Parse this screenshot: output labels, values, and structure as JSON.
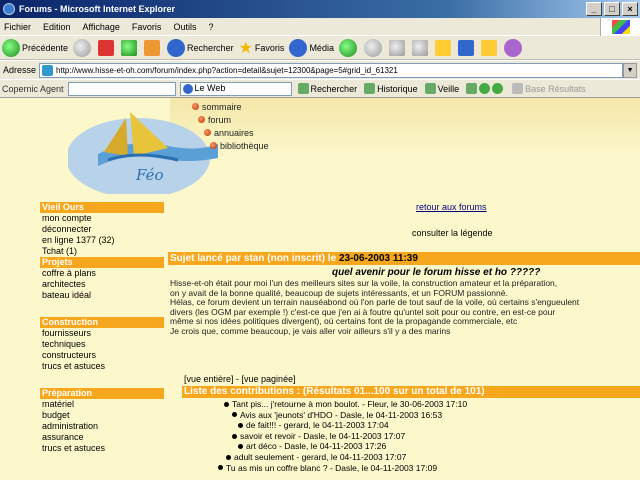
{
  "window": {
    "title": "Forums - Microsoft Internet Explorer",
    "controls": [
      "_",
      "□",
      "×"
    ]
  },
  "menu": [
    "Fichier",
    "Edition",
    "Affichage",
    "Favoris",
    "Outils",
    "?"
  ],
  "toolbar": {
    "back": "Précédente",
    "search": "Rechercher",
    "favorites": "Favoris",
    "media": "Média"
  },
  "address": {
    "label": "Adresse",
    "url": "http://www.hisse-et-oh.com/forum/index.php?action=detail&sujet=12300&page=5#grid_id_61321"
  },
  "searchbar": {
    "label": "Copernic Agent",
    "engine": "Le Web",
    "find": "Rechercher",
    "history": "Historique",
    "watch": "Veille",
    "results": "Base Résultats"
  },
  "site": {
    "logo_text": "Féo",
    "topnav": [
      "sommaire",
      "forum",
      "annuaires",
      "bibliothèque"
    ]
  },
  "sidebar": {
    "sections": [
      {
        "head": "Vieil Ours",
        "links": [
          "mon compte",
          "déconnecter",
          "en ligne 1377 (32)",
          "Tchat (1)"
        ]
      },
      {
        "head": "Projets",
        "links": [
          "coffre à plans",
          "architectes",
          "bateau idéal"
        ]
      },
      {
        "head": "Construction",
        "links": [
          "fournisseurs",
          "techniques",
          "constructeurs",
          "trucs et astuces"
        ]
      },
      {
        "head": "Préparation",
        "links": [
          "matériel",
          "budget",
          "administration",
          "assurance",
          "trucs et astuces"
        ]
      }
    ]
  },
  "main": {
    "back_link": "retour aux forums",
    "legend_link": "consulter la légende",
    "subject_prefix": "Sujet lancé par stan (non inscrit) le ",
    "subject_date": "23-06-2003 11:39",
    "subject_title": "quel avenir pour le forum hisse et ho ?????",
    "body": [
      "Hisse-et-oh était pour moi l'un des meilleurs sites sur la voile, la construction amateur et la préparation,",
      "on y avait de la bonne qualité, beaucoup de sujets intéressants, et un FORUM passionné.",
      "Hélas, ce forum devient un terrain nauséabond où l'on parle de tout sauf de la voile, où certains s'engueulent",
      "divers (les OGM par exemple !) c'est-ce que j'en ai à foutre qu'untel soit pour ou contre, en est-ce pour",
      "même si nos idées politiques divergent), où certains font de la propagande commerciale, etc",
      "Je crois que, comme beaucoup, je vais aller voir ailleurs s'il y a des marins"
    ],
    "view_full": "[vue entière]",
    "view_sep": " - ",
    "view_paged": "[vue paginée]",
    "list_title": "Liste des contributions : (Résultats 01...100 sur un total de 101)",
    "threads": [
      "Tant pis... j'retourne à mon boulot. - Fleur, le 30-06-2003 17:10",
      "Avis aux 'jeunots' d'HDO - Dasle, le 04-11-2003 16:53",
      "de fait!!! - gerard, le 04-11-2003 17:04",
      "savoir et revoir - Dasle, le 04-11-2003 17:07",
      "art déco - Dasle, le 04-11-2003 17:26",
      "adult seulement - gerard, le 04-11-2003 17:07",
      "Tu as mis un coffre blanc ? - Dasle, le 04-11-2003 17:09"
    ]
  }
}
